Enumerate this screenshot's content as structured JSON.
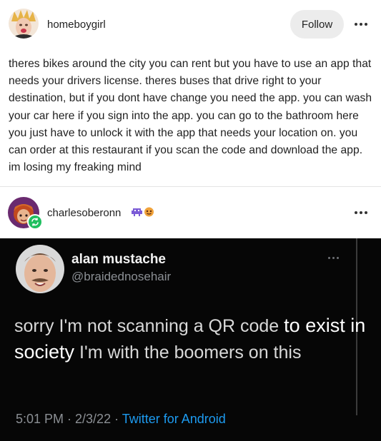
{
  "post": {
    "username": "homeboygirl",
    "follow_label": "Follow",
    "text": "theres bikes around the city you can rent but you have to use an app that needs your drivers license. theres buses that drive right to your destination, but if you dont have change you need the app. you can wash your car here if you sign into the app. you can go to the bathroom here you just have to unlock it with the app that needs your location on. you can order at this restaurant if you scan the code and download the app. im losing my freaking mind"
  },
  "reblog": {
    "username": "charlesoberonn",
    "badge_icons": [
      "alien-monster-emoji",
      "orange-face-emoji"
    ]
  },
  "tweet": {
    "name": "alan mustache",
    "handle": "@braidednosehair",
    "text_part1": "sorry I'm not scanning a QR code ",
    "text_highlight1": "to exist in society",
    "text_part2": " I'm with the boomers on this",
    "time": "5:01 PM · 2/3/22 · ",
    "source": "Twitter for Android"
  },
  "colors": {
    "follow_bg": "#ececec",
    "reblog_badge": "#1fbf5f",
    "tweet_bg": "#060606",
    "twitter_link": "#1d9bf0"
  }
}
